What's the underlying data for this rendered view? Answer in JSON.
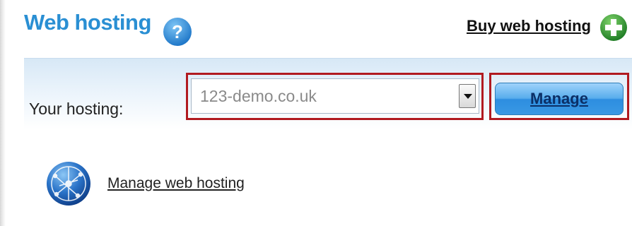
{
  "header": {
    "title": "Web hosting",
    "help_icon": "question-mark-icon",
    "buy_link": "Buy web hosting",
    "buy_icon": "plus-circle-icon"
  },
  "hosting": {
    "label": "Your hosting:",
    "selected_value": "123-demo.co.uk",
    "manage_button": "Manage"
  },
  "links": {
    "manage_web_hosting": "Manage web hosting",
    "globe_icon": "globe-icon"
  },
  "colors": {
    "title": "#2a8fd3",
    "highlight_border": "#b11a20",
    "button_blue": "#3a98e4",
    "plus_green": "#2e9b32"
  }
}
